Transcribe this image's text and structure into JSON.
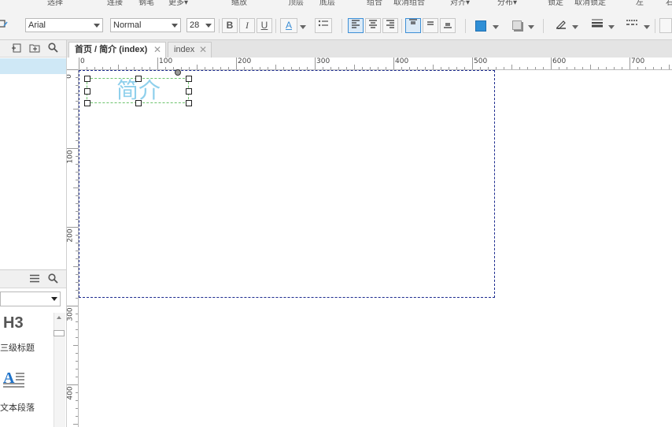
{
  "menu": {
    "items": [
      "选择",
      "连接",
      "钢笔",
      "更多▾",
      "缩放",
      "顶层",
      "底层",
      "组合",
      "取消组合",
      "对齐▾",
      "分布▾",
      "锁定",
      "取消锁定",
      "左",
      "右"
    ]
  },
  "toolbar": {
    "font_family": "Arial",
    "font_style": "Normal",
    "font_size": "28",
    "bold": "B",
    "italic": "I",
    "underline": "U",
    "font_color_glyph": "A",
    "fill_color": "#2f8fd6"
  },
  "left_pane": {
    "widget_h3_label": "H3",
    "widget_h3_caption": "三级标题",
    "widget_para_caption": "文本段落",
    "widget_para_glyph": "A"
  },
  "tabs": [
    {
      "label": "首页 / 简介 (index)",
      "active": true
    },
    {
      "label": "index",
      "active": false
    }
  ],
  "ruler": {
    "h_labels": [
      "0",
      "100",
      "200",
      "300",
      "400",
      "500",
      "600",
      "700"
    ],
    "v_labels": [
      "0",
      "100",
      "200",
      "300",
      "400"
    ]
  },
  "canvas": {
    "widget_text": "简介",
    "widget_text_color": "#8fd0ec",
    "page_border_color": "#1c2b8f"
  }
}
